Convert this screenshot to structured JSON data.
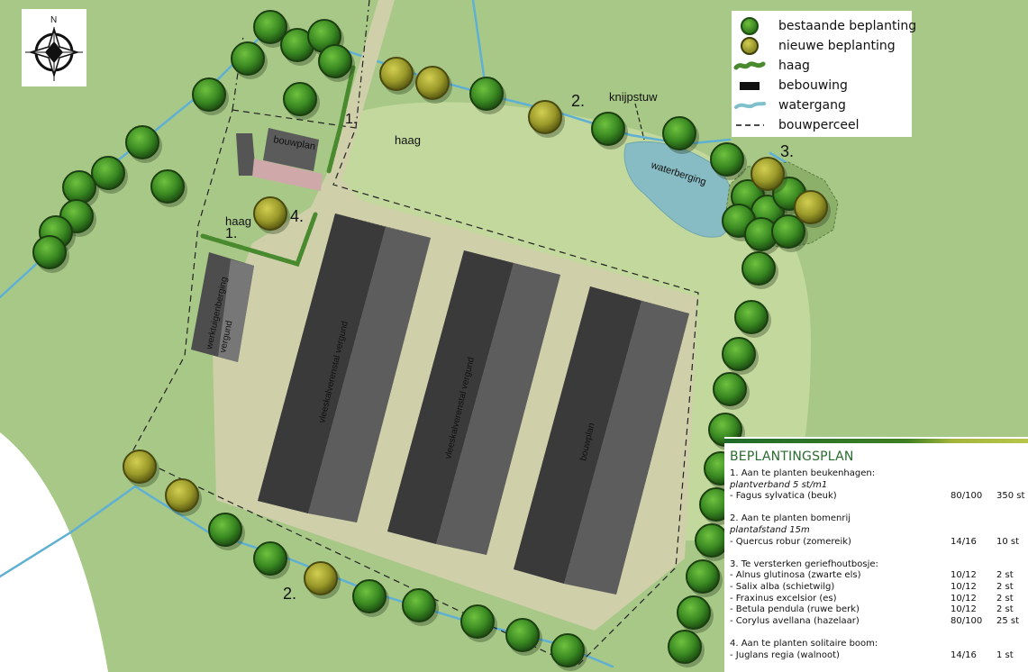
{
  "compass": {
    "north_label": "N"
  },
  "legend": {
    "items": [
      {
        "symbol": "tree-existing",
        "label": "bestaande beplanting"
      },
      {
        "symbol": "tree-new",
        "label": "nieuwe beplanting"
      },
      {
        "symbol": "hedge",
        "label": "haag"
      },
      {
        "symbol": "building",
        "label": "bebouwing"
      },
      {
        "symbol": "watercourse",
        "label": "watergang"
      },
      {
        "symbol": "plot-boundary",
        "label": "bouwperceel"
      }
    ]
  },
  "map_labels": {
    "haag_top": "haag",
    "haag_left": "haag",
    "knijpstuw": "knijpstuw",
    "waterberging": "waterberging",
    "bouwplan_small": "bouwplan",
    "werktuigenberging": "werktuigenberging",
    "vergund_small": "vergund",
    "stal1": "vleeskalverenstal vergund",
    "stal2": "vleeskalverenstal vergund",
    "bouwplan_large": "bouwplan",
    "num_1a": "1.",
    "num_1b": "1.",
    "num_2a": "2.",
    "num_2b": "2.",
    "num_3": "3.",
    "num_4": "4."
  },
  "planting_plan": {
    "title": "BEPLANTINGSPLAN",
    "lines": [
      {
        "text": "1. Aan te planten beukenhagen:",
        "italic": false,
        "c1": "",
        "c2": ""
      },
      {
        "text": "plantverband 5 st/m1",
        "italic": true,
        "c1": "",
        "c2": ""
      },
      {
        "text": "- Fagus sylvatica (beuk)",
        "italic": false,
        "c1": "80/100",
        "c2": "350 st"
      },
      {
        "text": "",
        "italic": false,
        "c1": "",
        "c2": ""
      },
      {
        "text": "2. Aan te planten bomenrij",
        "italic": false,
        "c1": "",
        "c2": ""
      },
      {
        "text": "plantafstand 15m",
        "italic": true,
        "c1": "",
        "c2": ""
      },
      {
        "text": "- Quercus robur (zomereik)",
        "italic": false,
        "c1": "14/16",
        "c2": "10 st"
      },
      {
        "text": "",
        "italic": false,
        "c1": "",
        "c2": ""
      },
      {
        "text": "3. Te versterken geriefhoutbosje:",
        "italic": false,
        "c1": "",
        "c2": ""
      },
      {
        "text": "- Alnus glutinosa (zwarte els)",
        "italic": false,
        "c1": "10/12",
        "c2": "2 st"
      },
      {
        "text": "- Salix alba (schietwilg)",
        "italic": false,
        "c1": "10/12",
        "c2": "2 st"
      },
      {
        "text": "- Fraxinus excelsior (es)",
        "italic": false,
        "c1": "10/12",
        "c2": "2 st"
      },
      {
        "text": "- Betula pendula (ruwe berk)",
        "italic": false,
        "c1": "10/12",
        "c2": "2 st"
      },
      {
        "text": "- Corylus avellana (hazelaar)",
        "italic": false,
        "c1": "80/100",
        "c2": "25 st"
      },
      {
        "text": "",
        "italic": false,
        "c1": "",
        "c2": ""
      },
      {
        "text": "4. Aan te planten solitaire boom:",
        "italic": false,
        "c1": "",
        "c2": ""
      },
      {
        "text": "- Juglans regia (walnoot)",
        "italic": false,
        "c1": "14/16",
        "c2": "1 st"
      }
    ]
  },
  "colors": {
    "meadow": "#a9c98a",
    "field_light": "#c3d99d",
    "yard": "#cfcfaa",
    "building_dark": "#3b3b3b",
    "building_mid": "#5b5b5b",
    "water": "#8fbfc3",
    "watercourse": "#6db3cf",
    "tree_existing": "#3f8a25",
    "tree_new": "#9a9a2c",
    "hedge": "#4f8f35"
  }
}
